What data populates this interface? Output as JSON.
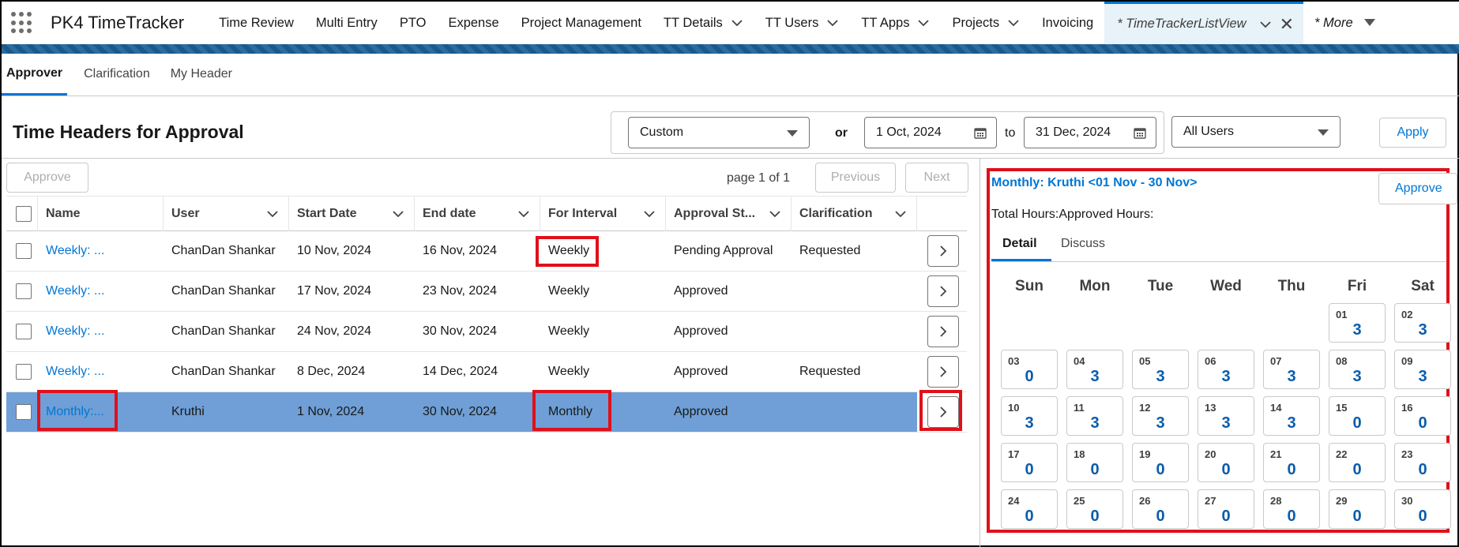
{
  "app": {
    "name": "PK4 TimeTracker"
  },
  "nav": {
    "items": [
      {
        "label": "Time Review",
        "chevron": false
      },
      {
        "label": "Multi Entry",
        "chevron": false
      },
      {
        "label": "PTO",
        "chevron": false
      },
      {
        "label": "Expense",
        "chevron": false
      },
      {
        "label": "Project Management",
        "chevron": false
      },
      {
        "label": "TT Details",
        "chevron": true
      },
      {
        "label": "TT Users",
        "chevron": true
      },
      {
        "label": "TT Apps",
        "chevron": true
      },
      {
        "label": "Projects",
        "chevron": true
      },
      {
        "label": "Invoicing",
        "chevron": false
      }
    ],
    "active_tab": "* TimeTrackerListView",
    "more": "* More"
  },
  "subtabs": [
    "Approver",
    "Clarification",
    "My Header"
  ],
  "page": {
    "title": "Time Headers for Approval"
  },
  "filters": {
    "range": "Custom",
    "or_label": "or",
    "from": "1 Oct, 2024",
    "to_label": "to",
    "to": "31 Dec, 2024",
    "users": "All Users",
    "apply": "Apply"
  },
  "table_controls": {
    "approve": "Approve",
    "page_info": "page 1 of 1",
    "previous": "Previous",
    "next": "Next"
  },
  "table": {
    "columns": [
      "Name",
      "User",
      "Start Date",
      "End date",
      "For Interval",
      "Approval St...",
      "Clarification"
    ],
    "rows": [
      {
        "name": "Weekly: ...",
        "user": "ChanDan Shankar",
        "start": "10 Nov, 2024",
        "end": "16 Nov, 2024",
        "interval": "Weekly",
        "status": "Pending Approval",
        "clarification": "Requested",
        "selected": false
      },
      {
        "name": "Weekly: ...",
        "user": "ChanDan Shankar",
        "start": "17 Nov, 2024",
        "end": "23 Nov, 2024",
        "interval": "Weekly",
        "status": "Approved",
        "clarification": "",
        "selected": false
      },
      {
        "name": "Weekly: ...",
        "user": "ChanDan Shankar",
        "start": "24 Nov, 2024",
        "end": "30 Nov, 2024",
        "interval": "Weekly",
        "status": "Approved",
        "clarification": "",
        "selected": false
      },
      {
        "name": "Weekly: ...",
        "user": "ChanDan Shankar",
        "start": "8 Dec, 2024",
        "end": "14 Dec, 2024",
        "interval": "Weekly",
        "status": "Approved",
        "clarification": "Requested",
        "selected": false
      },
      {
        "name": "Monthly:...",
        "user": "Kruthi",
        "start": "1 Nov, 2024",
        "end": "30 Nov, 2024",
        "interval": "Monthly",
        "status": "Approved",
        "clarification": "",
        "selected": true
      }
    ]
  },
  "panel": {
    "title": "Monthly: Kruthi <01 Nov - 30 Nov>",
    "approve": "Approve",
    "totals": "Total Hours:Approved Hours:",
    "tabs": [
      "Detail",
      "Discuss"
    ],
    "weekdays": [
      "Sun",
      "Mon",
      "Tue",
      "Wed",
      "Thu",
      "Fri",
      "Sat"
    ],
    "days": [
      {
        "d": "01",
        "h": "3"
      },
      {
        "d": "02",
        "h": "3"
      },
      {
        "d": "03",
        "h": "0"
      },
      {
        "d": "04",
        "h": "3"
      },
      {
        "d": "05",
        "h": "3"
      },
      {
        "d": "06",
        "h": "3"
      },
      {
        "d": "07",
        "h": "3"
      },
      {
        "d": "08",
        "h": "3"
      },
      {
        "d": "09",
        "h": "3"
      },
      {
        "d": "10",
        "h": "3"
      },
      {
        "d": "11",
        "h": "3"
      },
      {
        "d": "12",
        "h": "3"
      },
      {
        "d": "13",
        "h": "3"
      },
      {
        "d": "14",
        "h": "3"
      },
      {
        "d": "15",
        "h": "0"
      },
      {
        "d": "16",
        "h": "0"
      },
      {
        "d": "17",
        "h": "0"
      },
      {
        "d": "18",
        "h": "0"
      },
      {
        "d": "19",
        "h": "0"
      },
      {
        "d": "20",
        "h": "0"
      },
      {
        "d": "21",
        "h": "0"
      },
      {
        "d": "22",
        "h": "0"
      },
      {
        "d": "23",
        "h": "0"
      },
      {
        "d": "24",
        "h": "0"
      },
      {
        "d": "25",
        "h": "0"
      },
      {
        "d": "26",
        "h": "0"
      },
      {
        "d": "27",
        "h": "0"
      },
      {
        "d": "28",
        "h": "0"
      },
      {
        "d": "29",
        "h": "0"
      },
      {
        "d": "30",
        "h": "0"
      }
    ]
  },
  "colors": {
    "brand": "#0176d3",
    "highlight": "#e0101a",
    "selected_row": "#6f9fd6",
    "banner": "#1b5f96"
  }
}
